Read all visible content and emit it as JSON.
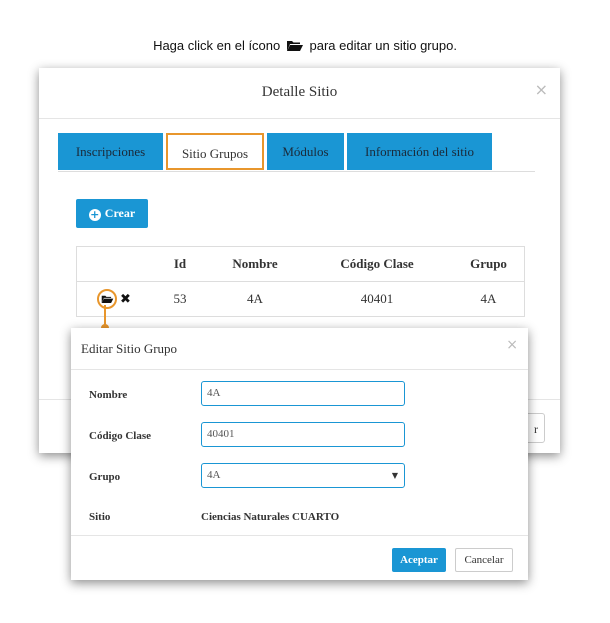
{
  "instruction": {
    "before": "Haga click en el ícono",
    "after": "para editar un sitio grupo."
  },
  "outer_modal": {
    "title": "Detalle Sitio",
    "close": "×",
    "tabs": [
      {
        "label": "Inscripciones"
      },
      {
        "label": "Sitio Grupos"
      },
      {
        "label": "Módulos"
      },
      {
        "label": "Información del sitio"
      }
    ],
    "crear_label": "Crear",
    "table": {
      "headers": [
        "",
        "Id",
        "Nombre",
        "Código Clase",
        "Grupo"
      ],
      "rows": [
        {
          "id": "53",
          "nombre": "4A",
          "codigo": "40401",
          "grupo": "4A"
        }
      ]
    },
    "footer_button_partial": "r"
  },
  "inner_modal": {
    "title": "Editar Sitio Grupo",
    "close": "×",
    "fields": {
      "nombre_label": "Nombre",
      "nombre_value": "4A",
      "codigo_label": "Código Clase",
      "codigo_value": "40401",
      "grupo_label": "Grupo",
      "grupo_value": "4A",
      "sitio_label": "Sitio",
      "sitio_value": "Ciencias Naturales CUARTO"
    },
    "aceptar_label": "Aceptar",
    "cancelar_label": "Cancelar"
  },
  "colors": {
    "accent": "#1a96d4",
    "highlight": "#e8962c"
  }
}
